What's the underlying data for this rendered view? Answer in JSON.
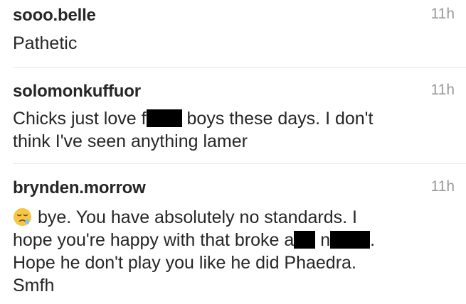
{
  "comments": [
    {
      "username": "sooo.belle",
      "time": "11h",
      "text": "Pathetic"
    },
    {
      "username": "solomonkuffuor",
      "time": "11h",
      "line1a": "Chicks just love f",
      "line1b": " boys these days. I don't",
      "line2": "think I've seen anything lamer"
    },
    {
      "username": "brynden.morrow",
      "time": "11h",
      "emoji": "sleepy-face-emoji",
      "line1": "bye. You have absolutely no standards. I",
      "line2a": "hope you're happy with that broke a",
      "line2b": " n",
      "line2c": ".",
      "line3": "Hope he don't play you like he did Phaedra.",
      "line4": "Smfh"
    }
  ]
}
